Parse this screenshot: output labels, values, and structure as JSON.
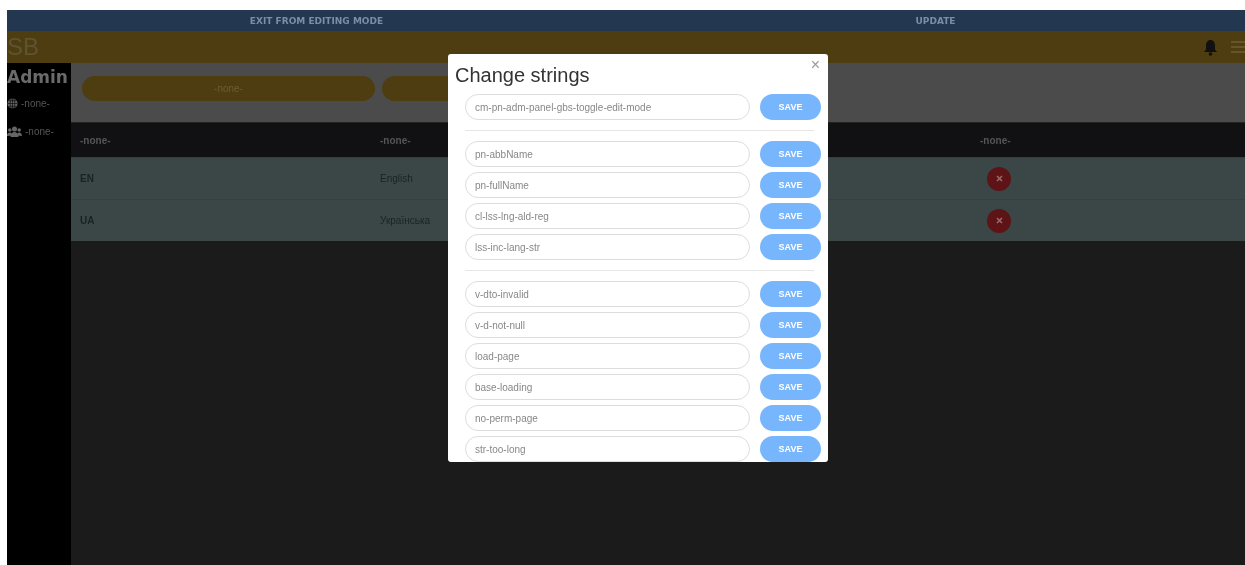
{
  "top_bar": {
    "buttons": [
      "EXIT FROM EDITING MODE",
      "UPDATE"
    ]
  },
  "header": {
    "logo": "SB"
  },
  "sidebar": {
    "title": "Admin",
    "items": [
      {
        "label": "-none-"
      },
      {
        "label": "-none-"
      }
    ]
  },
  "filter_buttons": [
    "-none-"
  ],
  "table": {
    "columns": [
      "-none-",
      "-none-",
      "-none-"
    ],
    "rows": [
      {
        "cells": [
          "EN",
          "English"
        ]
      },
      {
        "cells": [
          "UA",
          "Українська"
        ]
      }
    ]
  },
  "dialog": {
    "title": "Change strings",
    "close": "×",
    "groups": [
      [
        {
          "value": "cm-pn-adm-panel-gbs-toggle-edit-mode",
          "button": "SAVE"
        }
      ],
      [
        {
          "value": "pn-abbName",
          "button": "SAVE"
        },
        {
          "value": "pn-fullName",
          "button": "SAVE"
        },
        {
          "value": "cl-lss-lng-ald-reg",
          "button": "SAVE"
        },
        {
          "value": "lss-inc-lang-str",
          "button": "SAVE"
        }
      ],
      [
        {
          "value": "v-dto-invalid",
          "button": "SAVE"
        },
        {
          "value": "v-d-not-null",
          "button": "SAVE"
        },
        {
          "value": "load-page",
          "button": "SAVE"
        },
        {
          "value": "base-loading",
          "button": "SAVE"
        },
        {
          "value": "no-perm-page",
          "button": "SAVE"
        },
        {
          "value": "str-too-long",
          "button": "SAVE"
        }
      ]
    ]
  }
}
